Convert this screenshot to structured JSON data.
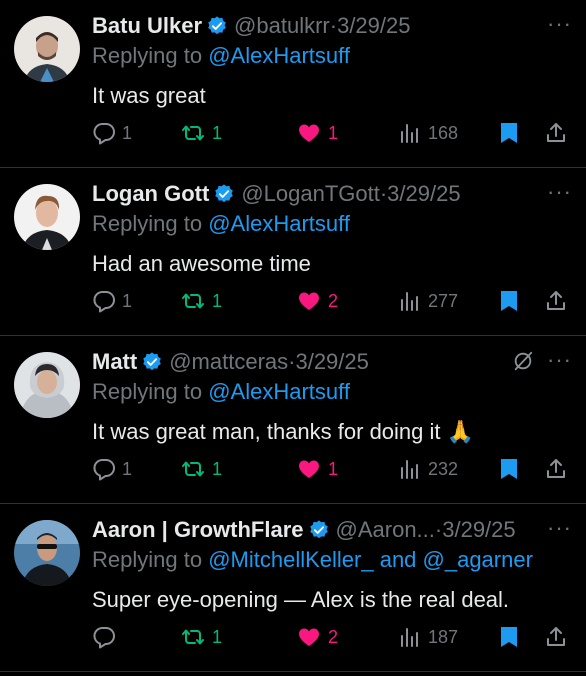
{
  "tweets": [
    {
      "name": "Batu Ulker",
      "handle": "@batulkrr",
      "separator": "·",
      "date": "3/29/25",
      "replying_prefix": "Replying to",
      "replying_to": "@AlexHartsuff",
      "text": "It was great",
      "text_emoji": "",
      "stats": {
        "replies": "1",
        "reposts": "1",
        "likes": "1",
        "views": "168"
      },
      "more_label": "···"
    },
    {
      "name": "Logan Gott",
      "handle": "@LoganTGott",
      "separator": "·",
      "date": "3/29/25",
      "replying_prefix": "Replying to",
      "replying_to": "@AlexHartsuff",
      "text": "Had an awesome time",
      "text_emoji": "",
      "stats": {
        "replies": "1",
        "reposts": "1",
        "likes": "2",
        "views": "277"
      },
      "more_label": "···"
    },
    {
      "name": "Matt",
      "handle": "@mattceras",
      "separator": "·",
      "date": "3/29/25",
      "replying_prefix": "Replying to",
      "replying_to": "@AlexHartsuff",
      "text": "It was great man, thanks for doing it ",
      "text_emoji": "🙏",
      "stats": {
        "replies": "1",
        "reposts": "1",
        "likes": "1",
        "views": "232"
      },
      "more_label": "···"
    },
    {
      "name": "Aaron | GrowthFlare",
      "handle": "@Aaron...",
      "separator": "·",
      "date": "3/29/25",
      "replying_prefix": "Replying to",
      "replying_to": "@MitchellKeller_ and @_agarner",
      "text": "Super eye-opening — Alex is the real deal.",
      "text_emoji": "",
      "stats": {
        "replies": "",
        "reposts": "1",
        "likes": "2",
        "views": "187"
      },
      "more_label": "···"
    }
  ],
  "colors": {
    "background": "#000000",
    "text": "#e7e9ea",
    "muted": "#71767b",
    "link": "#1d9bf0",
    "repost": "#00ba7c",
    "like": "#f91880",
    "verified": "#1d9bf0"
  },
  "icons": [
    "verified-badge-icon",
    "reply-icon",
    "repost-icon",
    "heart-icon",
    "views-icon",
    "bookmark-icon",
    "share-icon",
    "more-icon",
    "grok-icon"
  ]
}
